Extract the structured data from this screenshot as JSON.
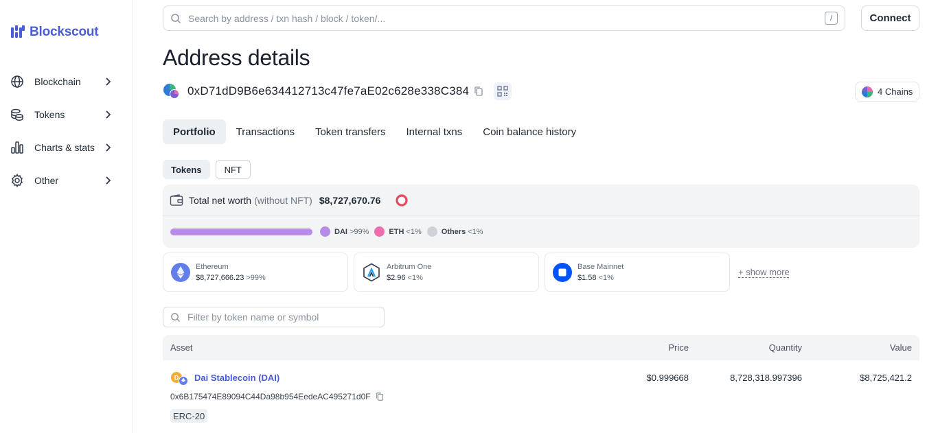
{
  "brand": {
    "name": "Blockscout",
    "color": "#4a5cd6"
  },
  "sidebar": {
    "items": [
      {
        "label": "Blockchain",
        "icon": "globe-icon"
      },
      {
        "label": "Tokens",
        "icon": "coins-icon"
      },
      {
        "label": "Charts & stats",
        "icon": "bar-chart-icon"
      },
      {
        "label": "Other",
        "icon": "gear-icon"
      }
    ]
  },
  "search": {
    "placeholder": "Search by address / txn hash / block / token/...",
    "shortcut": "/"
  },
  "header": {
    "connect_label": "Connect"
  },
  "page": {
    "title": "Address details"
  },
  "address": {
    "hash": "0xD71dD9B6e634412713c47fe7aE02c628e338C384"
  },
  "chains_badge": {
    "label": "4 Chains"
  },
  "tabs": [
    {
      "label": "Portfolio",
      "active": true
    },
    {
      "label": "Transactions"
    },
    {
      "label": "Token transfers"
    },
    {
      "label": "Internal txns"
    },
    {
      "label": "Coin balance history"
    }
  ],
  "subtabs": [
    {
      "label": "Tokens",
      "active": true
    },
    {
      "label": "NFT"
    }
  ],
  "networth": {
    "label": "Total net worth",
    "sub": "(without NFT)",
    "value": "$8,727,670.76",
    "legend": [
      {
        "name": "DAI",
        "pct": ">99%",
        "color": "#b78be8"
      },
      {
        "name": "ETH",
        "pct": "<1%",
        "color": "#ee6fae"
      },
      {
        "name": "Others",
        "pct": "<1%",
        "color": "#cfd3d8"
      }
    ]
  },
  "chain_cards": [
    {
      "name": "Ethereum",
      "value": "$8,727,666.23",
      "pct": ">99%"
    },
    {
      "name": "Arbitrum One",
      "value": "$2.96",
      "pct": "<1%"
    },
    {
      "name": "Base Mainnet",
      "value": "$1.58",
      "pct": "<1%"
    }
  ],
  "show_more": "+ show more",
  "filter": {
    "placeholder": "Filter by token name or symbol"
  },
  "table": {
    "headers": {
      "asset": "Asset",
      "price": "Price",
      "quantity": "Quantity",
      "value": "Value"
    },
    "rows": [
      {
        "name": "Dai Stablecoin (DAI)",
        "contract": "0x6B175474E89094C44Da98b954EedeAC495271d0F",
        "standard": "ERC-20",
        "price": "$0.999668",
        "quantity": "8,728,318.997396",
        "value": "$8,725,421.2"
      }
    ]
  }
}
